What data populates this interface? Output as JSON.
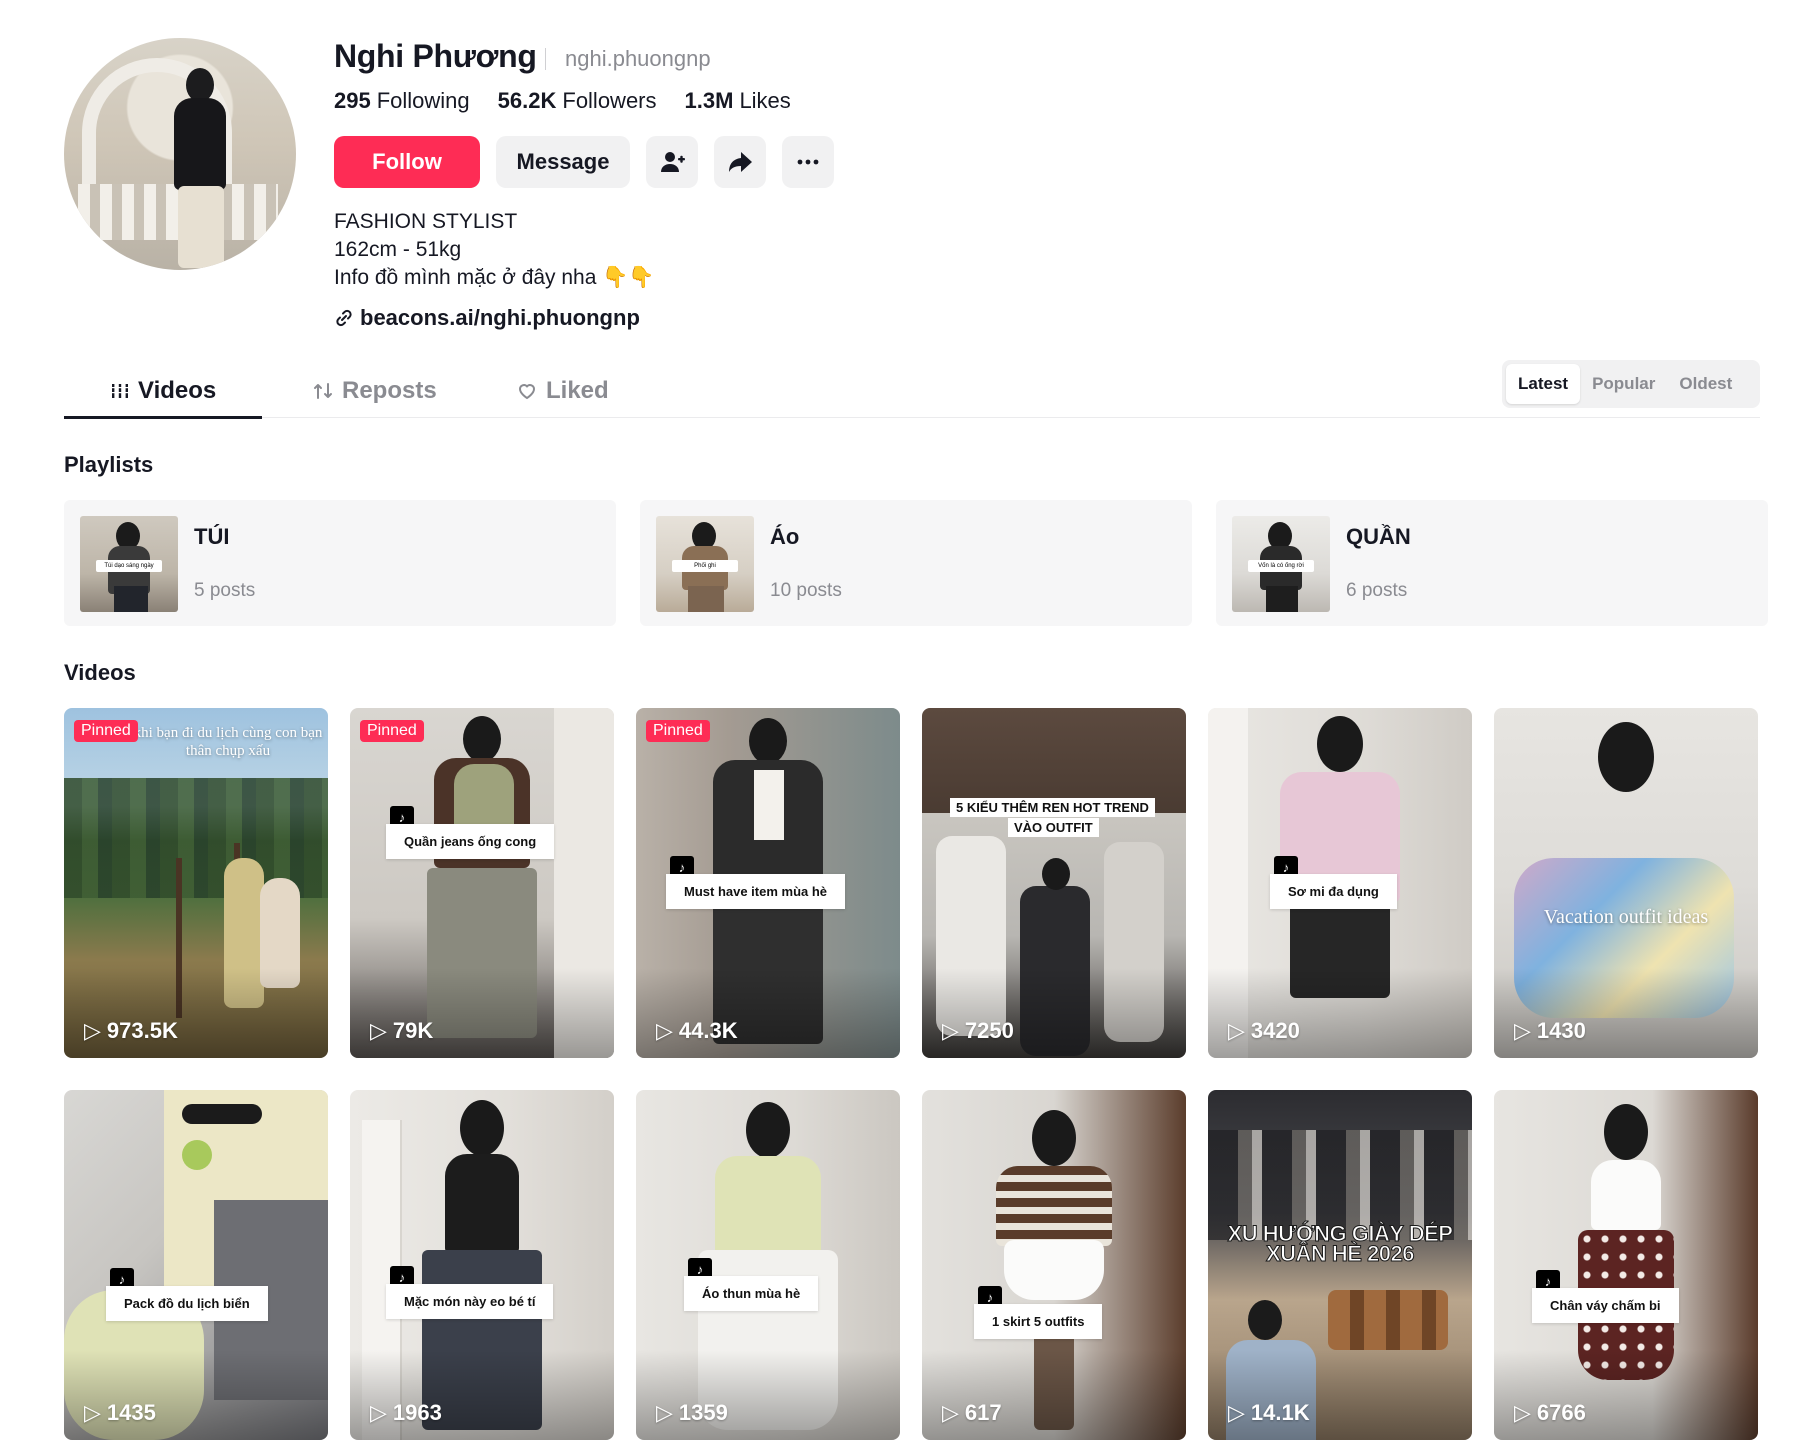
{
  "profile": {
    "name": "Nghi Phương",
    "username": "nghi.phuongnp",
    "following_count": "295",
    "following_label": "Following",
    "followers_count": "56.2K",
    "followers_label": "Followers",
    "likes_count": "1.3M",
    "likes_label": "Likes",
    "bio_lines": [
      "FASHION STYLIST",
      "162cm - 51kg",
      "Info đồ mình mặc ở đây nha 👇👇"
    ],
    "link": "beacons.ai/nghi.phuongnp"
  },
  "actions": {
    "follow_label": "Follow",
    "message_label": "Message",
    "add_friend_icon": "person-add-icon",
    "share_icon": "share-arrow-icon",
    "more_icon": "more-dots-icon"
  },
  "tabs": [
    {
      "label": "Videos",
      "icon": "grid-icon",
      "active": true
    },
    {
      "label": "Reposts",
      "icon": "repost-icon",
      "active": false
    },
    {
      "label": "Liked",
      "icon": "heart-outline-icon",
      "active": false
    }
  ],
  "sort": {
    "options": [
      "Latest",
      "Popular",
      "Oldest"
    ],
    "selected": "Latest"
  },
  "playlists_title": "Playlists",
  "playlists": [
    {
      "title": "TÚI",
      "count": "5 posts",
      "thumb_caption": "Túi dạo sáng ngày"
    },
    {
      "title": "Áo",
      "count": "10 posts",
      "thumb_caption": "Phối ghi"
    },
    {
      "title": "QUẦN",
      "count": "6 posts",
      "thumb_caption": "Vốn là có ống rời"
    }
  ],
  "videos_title": "Videos",
  "videos": [
    {
      "views": "973.5K",
      "pinned": "Pinned",
      "caption": "khi bạn đi du lịch cùng con bạn thân chụp xấu"
    },
    {
      "views": "79K",
      "pinned": "Pinned",
      "caption": "Quần jeans ống cong"
    },
    {
      "views": "44.3K",
      "pinned": "Pinned",
      "caption": "Must have item mùa hè"
    },
    {
      "views": "7250",
      "pinned": "",
      "caption": "5 KIỂU THÊM REN HOT TREND",
      "caption2": "VÀO OUTFIT"
    },
    {
      "views": "3420",
      "pinned": "",
      "caption": "Sơ mi đa dụng"
    },
    {
      "views": "1430",
      "pinned": "",
      "caption": "Vacation outfit ideas"
    },
    {
      "views": "1435",
      "pinned": "",
      "caption": "Pack đồ du lịch biển"
    },
    {
      "views": "1963",
      "pinned": "",
      "caption": "Mặc món này eo bé tí"
    },
    {
      "views": "1359",
      "pinned": "",
      "caption": "Áo thun mùa hè"
    },
    {
      "views": "617",
      "pinned": "",
      "caption": "1 skirt 5 outfits"
    },
    {
      "views": "14.1K",
      "pinned": "",
      "caption": "XU HƯỚNG GIÀY DÉP",
      "caption2": "XUÂN HÈ 2026"
    },
    {
      "views": "6766",
      "pinned": "",
      "caption": "Chân váy chấm bi"
    }
  ],
  "colors": {
    "accent": "#fe2c55",
    "text_primary": "#161823",
    "text_secondary": "#8a8b91",
    "surface": "#f1f1f2"
  }
}
